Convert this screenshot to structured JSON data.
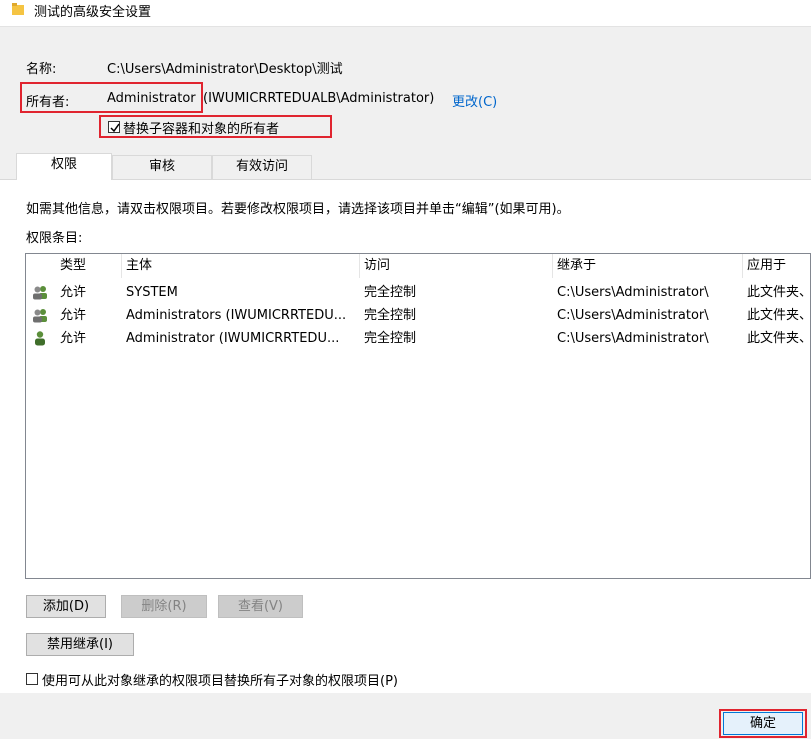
{
  "window": {
    "title": "测试的高级安全设置"
  },
  "name_row": {
    "label": "名称:",
    "value": "C:\\Users\\Administrator\\Desktop\\测试"
  },
  "owner_row": {
    "label": "所有者:",
    "value_name": "Administrator",
    "value_rest": "(IWUMICRRTEDUALB\\Administrator)",
    "change_link": "更改(C)"
  },
  "replace_owner": {
    "label": "替换子容器和对象的所有者",
    "checked": true
  },
  "tabs": [
    {
      "label": "权限",
      "active": true
    },
    {
      "label": "审核",
      "active": false
    },
    {
      "label": "有效访问",
      "active": false
    }
  ],
  "info_text": "如需其他信息，请双击权限项目。若要修改权限项目，请选择该项目并单击“编辑”(如果可用)。",
  "entries_label": "权限条目:",
  "table": {
    "columns": [
      "类型",
      "主体",
      "访问",
      "继承于",
      "应用于"
    ],
    "rows": [
      {
        "icon": "group-users-icon",
        "type": "允许",
        "principal": "SYSTEM",
        "access": "完全控制",
        "inherited": "C:\\Users\\Administrator\\",
        "applies": "此文件夹、"
      },
      {
        "icon": "group-users-icon",
        "type": "允许",
        "principal": "Administrators (IWUMICRRTEDU...",
        "access": "完全控制",
        "inherited": "C:\\Users\\Administrator\\",
        "applies": "此文件夹、"
      },
      {
        "icon": "single-user-icon",
        "type": "允许",
        "principal": "Administrator (IWUMICRRTEDU...",
        "access": "完全控制",
        "inherited": "C:\\Users\\Administrator\\",
        "applies": "此文件夹、"
      }
    ]
  },
  "buttons": {
    "add": "添加(D)",
    "remove": "删除(R)",
    "view": "查看(V)",
    "disable_inheritance": "禁用继承(I)",
    "ok": "确定"
  },
  "replace_child": {
    "label": "使用可从此对象继承的权限项目替换所有子对象的权限项目(P)",
    "checked": false
  },
  "colors": {
    "highlight_red": "#e0242f",
    "link_blue": "#0066cc",
    "folder_yellow": "#f5c443"
  }
}
